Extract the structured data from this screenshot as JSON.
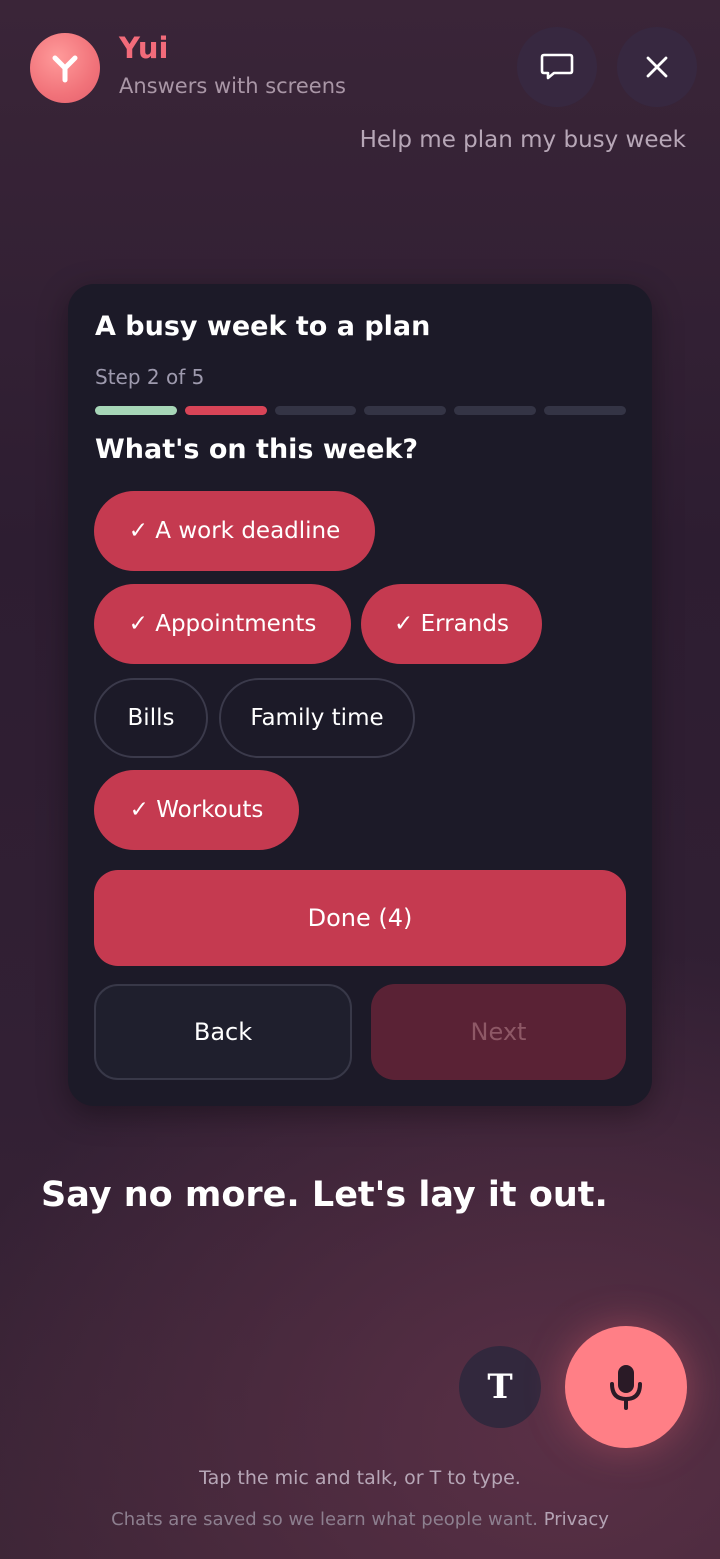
{
  "header": {
    "name": "Yui",
    "subtitle": "Answers with screens",
    "user_message": "Help me plan my busy week"
  },
  "card": {
    "title": "A busy week to a plan",
    "step_label": "Step 2 of 5",
    "progress": {
      "current_step": 2,
      "total_steps": 5
    },
    "question": "What's on this week?",
    "options": [
      {
        "label": "✓ A work deadline",
        "selected": true
      },
      {
        "label": "✓ Appointments",
        "selected": true
      },
      {
        "label": "✓ Errands",
        "selected": true
      },
      {
        "label": "Bills",
        "selected": false
      },
      {
        "label": "Family time",
        "selected": false
      },
      {
        "label": "✓ Workouts",
        "selected": true
      }
    ],
    "done_label": "Done (4)",
    "back_label": "Back",
    "next_label": "Next"
  },
  "reply": "Say no more. Let's lay it out.",
  "input": {
    "text_button_label": "T",
    "hint": "Tap the mic and talk, or T to type.",
    "footer_text": "Chats are saved so we learn what people want.",
    "privacy_link": "Privacy"
  },
  "colors": {
    "accent": "#c53a50",
    "brand": "#f26b7a",
    "mic": "#ff7f86",
    "progress_done": "#a7d6b8",
    "card_bg": "#1c1a28"
  }
}
